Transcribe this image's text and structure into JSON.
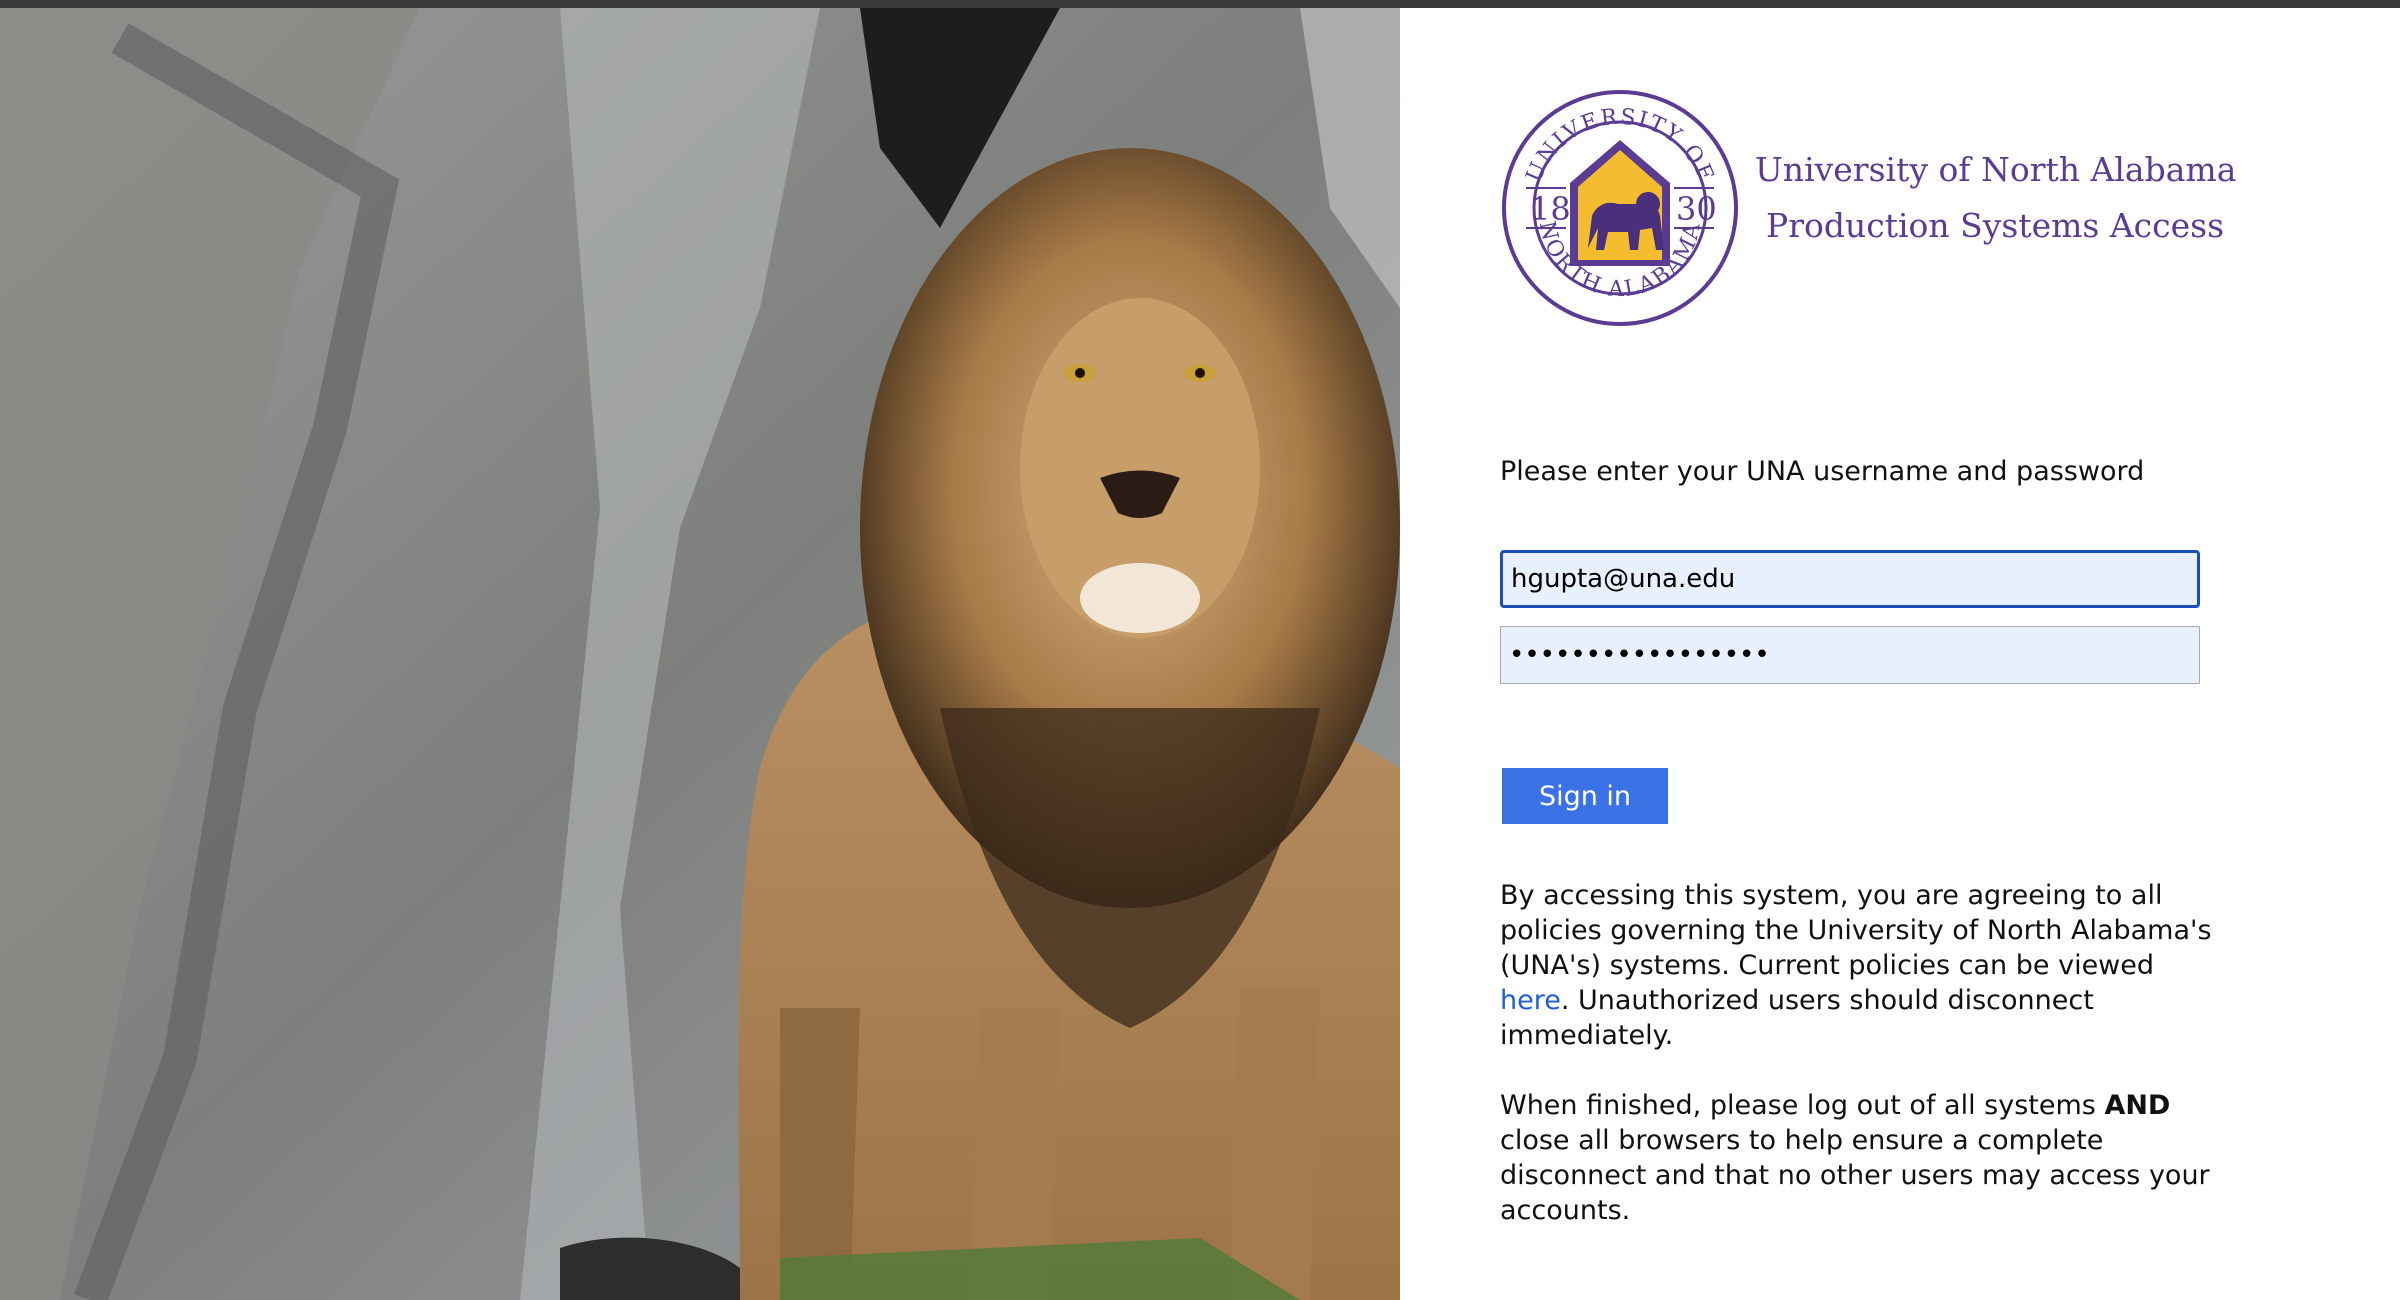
{
  "brand": {
    "title": "University of North Alabama",
    "subtitle": "Production Systems Access",
    "seal_top_text": "UNIVERSITY OF",
    "seal_bottom_text": "NORTH ALABAMA",
    "seal_year_left": "18",
    "seal_year_right": "30",
    "colors": {
      "purple": "#5b3c92",
      "gold": "#f3bd2f"
    }
  },
  "form": {
    "prompt": "Please enter your UNA username and password",
    "username_value": "hgupta@una.edu",
    "password_value": "•••••••••••••••••",
    "signin_label": "Sign in"
  },
  "notice": {
    "p1_text": "By accessing this system, you are agreeing to all policies governing the University of North Alabama's (UNA's) systems. Current policies can be viewed ",
    "p1_link": "here",
    "p1_tail": ". Unauthorized users should disconnect immediately.",
    "p2_text": "When finished, please log out of all systems ",
    "p2_bold": "AND",
    "p2_tail": " close all browsers to help ensure a complete disconnect and that no other users may access your accounts."
  },
  "colors": {
    "button_bg": "#3a72e6",
    "link": "#1f5fd6",
    "field_bg": "#e8f0fe",
    "field_focus_border": "#1c4eb8"
  }
}
